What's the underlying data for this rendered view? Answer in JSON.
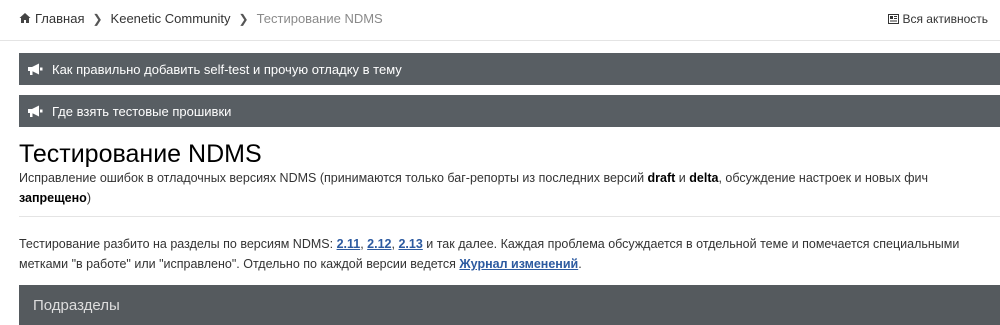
{
  "breadcrumb": {
    "home": "Главная",
    "community": "Keenetic Community",
    "current": "Тестирование NDMS"
  },
  "header": {
    "activity_label": "Вся активность"
  },
  "announcements": [
    {
      "label": "Как правильно добавить self-test и прочую отладку в тему",
      "icon": "megaphone-icon"
    },
    {
      "label": "Где взять тестовые прошивки",
      "icon": "megaphone-icon"
    }
  ],
  "forum": {
    "title": "Тестирование NDMS",
    "desc_part1": "Исправление ошибок в отладочных версиях NDMS (принимаются только баг-репорты из последних версий ",
    "desc_bold1": "draft",
    "desc_part2": " и ",
    "desc_bold2": "delta",
    "desc_part3": ", обсуждение настроек и новых фич ",
    "desc_bold3": "запрещено",
    "desc_part4": ")"
  },
  "intro": {
    "part1": "Тестирование разбито на разделы по версиям NDMS: ",
    "link1": "2.11",
    "sep1": ", ",
    "link2": "2.12",
    "sep2": ", ",
    "link3": "2.13",
    "part2": " и так далее. Каждая проблема обсуждается в отдельной теме и помечается специальными метками \"в работе\" или \"исправлено\". Отдельно по каждой версии ведется ",
    "changelog_link": "Журнал изменений",
    "part3": "."
  },
  "subsections": {
    "title": "Подразделы"
  },
  "colors": {
    "announce_bg": "#585e63",
    "subsection_bg": "#555a5e",
    "link": "#2c5aa0"
  }
}
